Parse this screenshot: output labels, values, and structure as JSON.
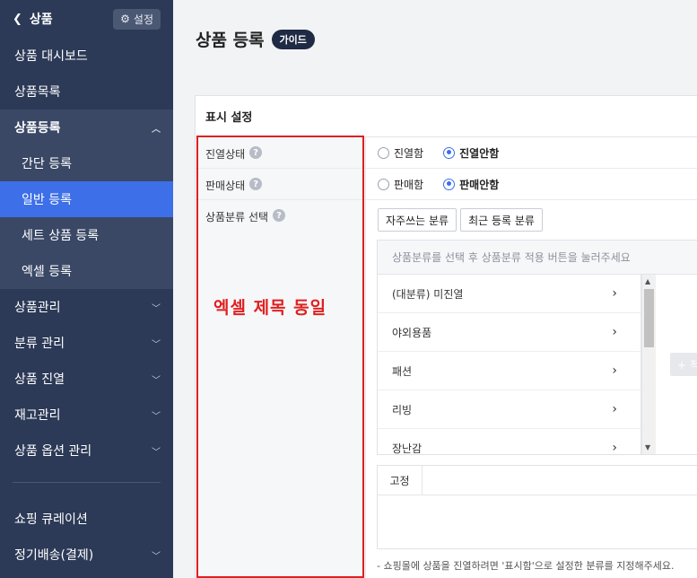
{
  "sidebar": {
    "back_label": "상품",
    "settings_label": "설정",
    "items": [
      {
        "label": "상품 대시보드"
      },
      {
        "label": "상품목록"
      },
      {
        "label": "상품등록"
      },
      {
        "label": "간단 등록"
      },
      {
        "label": "일반 등록"
      },
      {
        "label": "세트 상품 등록"
      },
      {
        "label": "엑셀 등록"
      },
      {
        "label": "상품관리"
      },
      {
        "label": "분류 관리"
      },
      {
        "label": "상품 진열"
      },
      {
        "label": "재고관리"
      },
      {
        "label": "상품 옵션 관리"
      },
      {
        "label": "쇼핑 큐레이션"
      },
      {
        "label": "정기배송(결제)"
      }
    ]
  },
  "page": {
    "title": "상품 등록",
    "guide_badge": "가이드"
  },
  "display_settings": {
    "section_title": "표시 설정",
    "display_status": {
      "label": "진열상태",
      "options": [
        "진열함",
        "진열안함"
      ],
      "selected": "진열안함"
    },
    "sale_status": {
      "label": "판매상태",
      "options": [
        "판매함",
        "판매안함"
      ],
      "selected": "판매안함"
    },
    "category": {
      "label": "상품분류 선택",
      "btn_frequent": "자주쓰는 분류",
      "btn_recent": "최근 등록 분류",
      "hint": "상품분류를 선택 후 상품분류 적용 버튼을 눌러주세요",
      "items": [
        "(대분류) 미진열",
        "야외용품",
        "패션",
        "리빙",
        "장난감"
      ],
      "add_button": "+ 적",
      "fixed_header": "고정",
      "note": "- 쇼핑몰에 상품을 진열하려면 '표시함'으로 설정한 분류를 지정해주세요."
    }
  },
  "annotation": {
    "text": "엑셀 제목 동일",
    "color": "#e02020"
  },
  "colors": {
    "sidebar_bg": "#2c3a57",
    "active_item": "#3d6fe8",
    "badge_bg": "#1f2a44"
  }
}
